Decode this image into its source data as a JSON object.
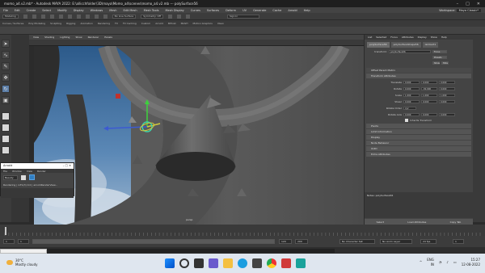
{
  "window": {
    "title": "momo_a4.v2.mb* - Autodesk MAYA 2022: E:\\allicchfolder\\3D\\maya\\Momo_a4\\scenes\\momo_a4.v2.mb   ---   polySurface56",
    "workspace_label": "Workspace:",
    "workspace_value": "Maya Classic*"
  },
  "menubar": [
    "File",
    "Edit",
    "Create",
    "Select",
    "Modify",
    "Display",
    "Windows",
    "Mesh",
    "Edit Mesh",
    "Mesh Tools",
    "Mesh Display",
    "Curves",
    "Surfaces",
    "Deform",
    "UV",
    "Generate",
    "Cache",
    "Arnold",
    "Help"
  ],
  "statusline": {
    "mode": "Modeling",
    "no_live": "No Live Surface",
    "symmetry": "Symmetry: Off",
    "sign_in": "Sign In"
  },
  "shelf_tabs": [
    "Curves / Surfaces",
    "Poly Modeling",
    "Sculpting",
    "Rigging",
    "Animation",
    "Rendering",
    "FX",
    "FX Caching",
    "Custom",
    "Arnold",
    "Bifrost",
    "MASH",
    "Motion Graphics",
    "XGen"
  ],
  "viewport": {
    "menu": [
      "View",
      "Shading",
      "Lighting",
      "Show",
      "Renderer",
      "Panels"
    ],
    "label": "persp"
  },
  "attribute_editor": {
    "tabs": [
      "List",
      "Selected",
      "Focus",
      "Attributes",
      "Display",
      "Show",
      "Help"
    ],
    "node_tabs": [
      "polySurface56",
      "polySurfaceShape56",
      "lambert1"
    ],
    "transform_label": "transform:",
    "transform_value": "polySurface56",
    "buttons": [
      "Focus",
      "Presets",
      "Show",
      "Hide"
    ],
    "section_transform": "Transform Attributes",
    "rows": [
      {
        "label": "Translate",
        "values": [
          "0.000",
          "0.000",
          "0.000"
        ]
      },
      {
        "label": "Rotate",
        "values": [
          "0.000",
          "-30.000",
          "0.000"
        ]
      },
      {
        "label": "Scale",
        "values": [
          "1.000",
          "1.000",
          "1.000"
        ]
      },
      {
        "label": "Shear",
        "values": [
          "0.000",
          "0.000",
          "0.000"
        ]
      },
      {
        "label": "Rotate Order",
        "values": [
          "xyz"
        ]
      },
      {
        "label": "Rotate Axis",
        "values": [
          "0.000",
          "0.000",
          "0.000"
        ]
      }
    ],
    "inherits": "Inherits Transform",
    "sections": [
      "Pivots",
      "Limit Information",
      "Display",
      "Node Behavior",
      "UUID",
      "Extra Attributes"
    ],
    "offset_parent": "Offset Parent Matrix",
    "notes_label": "Notes: polySurface56",
    "bottom": [
      "Select",
      "Load Attributes",
      "Copy Tab"
    ]
  },
  "render_window": {
    "title": "Arnold",
    "menu": [
      "File",
      "Window",
      "View",
      "Render"
    ],
    "select": "Beauty",
    "status": "Rendering | inFo(3) 0.0 | arnoldRenderView..."
  },
  "time": {
    "start": "1",
    "end": "120",
    "range_start": "1",
    "range_end": "120",
    "max": "200",
    "current": "1",
    "character_set": "No Character Set",
    "anim_layer": "No Anim Layer",
    "fps": "24 fps"
  },
  "command": {
    "lang": "MEL"
  },
  "taskbar": {
    "temp": "30°C",
    "weather": "Mostly cloudy",
    "lang1": "ENG",
    "lang2": "IN",
    "time": "15:27",
    "date": "12-08-2022"
  }
}
